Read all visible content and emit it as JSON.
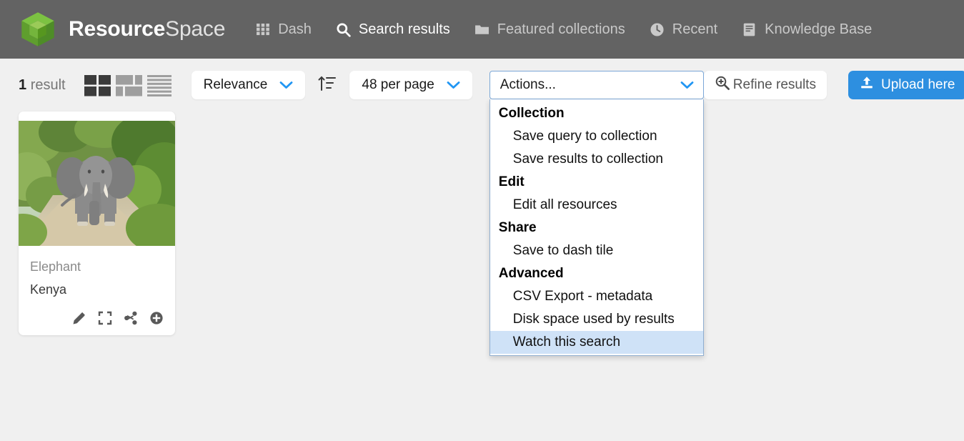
{
  "header": {
    "brand_bold": "Resource",
    "brand_light": "Space",
    "logo_color": "#6cb33f",
    "bar_color": "#636363",
    "nav": [
      {
        "label": "Dash",
        "icon": "grid-icon",
        "active": false
      },
      {
        "label": "Search results",
        "icon": "search-icon",
        "active": true
      },
      {
        "label": "Featured collections",
        "icon": "folder-icon",
        "active": false
      },
      {
        "label": "Recent",
        "icon": "clock-icon",
        "active": false
      },
      {
        "label": "Knowledge Base",
        "icon": "book-icon",
        "active": false
      }
    ]
  },
  "toolbar": {
    "result_count_number": "1",
    "result_count_label": "result",
    "view_modes": [
      {
        "name": "grid-view-icon",
        "active": true
      },
      {
        "name": "thumbnail-view-icon",
        "active": false
      },
      {
        "name": "list-view-icon",
        "active": false
      }
    ],
    "sort_select_value": "Relevance",
    "sort_direction_icon": "sort-ascending-icon",
    "per_page_value": "48 per page",
    "actions_placeholder": "Actions...",
    "refine_label": "Refine results",
    "refine_icon": "zoom-in-icon",
    "upload_label": "Upload here",
    "upload_icon": "upload-icon",
    "accent_blue": "#2196f3",
    "upload_button_color": "#2d8fe0"
  },
  "actions_dropdown": {
    "open": true,
    "highlight_color": "#cfe2f7",
    "groups": [
      {
        "label": "Collection",
        "items": [
          {
            "label": "Save query to collection",
            "selected": false
          },
          {
            "label": "Save results to collection",
            "selected": false
          }
        ]
      },
      {
        "label": "Edit",
        "items": [
          {
            "label": "Edit all resources",
            "selected": false
          }
        ]
      },
      {
        "label": "Share",
        "items": [
          {
            "label": "Save to dash tile",
            "selected": false
          }
        ]
      },
      {
        "label": "Advanced",
        "items": [
          {
            "label": "CSV Export - metadata",
            "selected": false
          },
          {
            "label": "Disk space used by results",
            "selected": false
          },
          {
            "label": "Watch this search",
            "selected": true
          }
        ]
      }
    ]
  },
  "results": {
    "cards": [
      {
        "title": "Elephant",
        "subtitle": "Kenya",
        "image_alt": "elephant-on-dirt-path",
        "tools": [
          {
            "name": "edit-pencil-icon"
          },
          {
            "name": "expand-icon"
          },
          {
            "name": "share-icon"
          },
          {
            "name": "add-to-collection-icon"
          }
        ]
      }
    ]
  }
}
